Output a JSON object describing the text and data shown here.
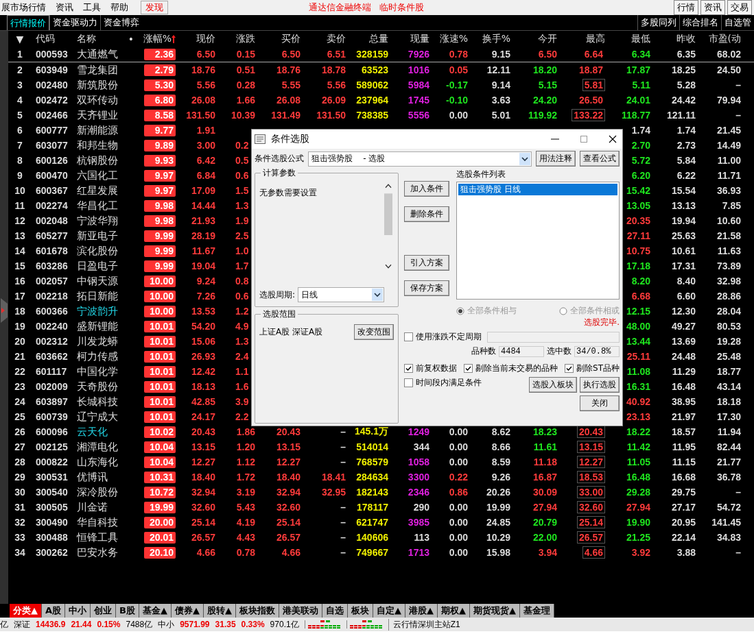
{
  "menu_bar": {
    "items": [
      {
        "label": "展市场行情",
        "selected": false
      },
      {
        "label": "资讯",
        "selected": false
      },
      {
        "label": "工具",
        "selected": false
      },
      {
        "label": "帮助",
        "selected": false
      },
      {
        "label": "发现",
        "selected": true
      }
    ],
    "title": "通达信金融终端",
    "subtitle": "临时条件股",
    "buttons": [
      "行情",
      "资讯",
      "交易"
    ]
  },
  "tabs": [
    {
      "label": "行情报价",
      "selected": true
    },
    {
      "label": "资金驱动力",
      "selected": false
    },
    {
      "label": "资金博弈",
      "selected": false
    }
  ],
  "right_tabs": [
    "多股同列",
    "综合排名",
    "自选管"
  ],
  "table": {
    "columns": [
      {
        "label": "▼",
        "sorted": false
      },
      {
        "label": "代码",
        "sorted": false
      },
      {
        "label": "名称",
        "sorted": false
      },
      {
        "label": "•",
        "sorted": false
      },
      {
        "label": "涨幅%",
        "sorted": true
      },
      {
        "label": "现价",
        "sorted": false
      },
      {
        "label": "涨跌",
        "sorted": false
      },
      {
        "label": "买价",
        "sorted": false
      },
      {
        "label": "卖价",
        "sorted": false
      },
      {
        "label": "总量",
        "sorted": false
      },
      {
        "label": "现量",
        "sorted": false
      },
      {
        "label": "涨速%",
        "sorted": false
      },
      {
        "label": "换手%",
        "sorted": false
      },
      {
        "label": "今开",
        "sorted": false
      },
      {
        "label": "最高",
        "sorted": false
      },
      {
        "label": "最低",
        "sorted": false
      },
      {
        "label": "昨收",
        "sorted": false
      },
      {
        "label": "市盈(动",
        "sorted": false
      }
    ],
    "rows": [
      {
        "no": "1",
        "code": "000593",
        "name": "大通燃气",
        "highlighted": false,
        "pct": "2.36",
        "price": "6.50",
        "chg": "0.15",
        "bid": "6.50",
        "ask": "6.51",
        "vol": "328159",
        "cur": "7926",
        "buy_side": true,
        "speed": "0.78",
        "turnover": "9.15",
        "open": "6.50",
        "high": "6.64",
        "high_boxed": false,
        "low": "6.34",
        "prev": "6.35",
        "pe": "68.02"
      },
      {
        "no": "2",
        "code": "603949",
        "name": "雪龙集团",
        "highlighted": false,
        "pct": "2.79",
        "price": "18.76",
        "chg": "0.51",
        "bid": "18.76",
        "ask": "18.78",
        "vol": "63523",
        "cur": "1016",
        "buy_side": true,
        "speed": "0.05",
        "turnover": "12.11",
        "open": "18.20",
        "high": "18.87",
        "high_boxed": false,
        "low": "17.87",
        "prev": "18.25",
        "pe": "24.50"
      },
      {
        "no": "3",
        "code": "002480",
        "name": "新筑股份",
        "highlighted": false,
        "pct": "5.30",
        "price": "5.56",
        "chg": "0.28",
        "bid": "5.55",
        "ask": "5.56",
        "vol": "589062",
        "cur": "5984",
        "buy_side": true,
        "speed": "-0.17",
        "turnover": "9.14",
        "open": "5.15",
        "high": "5.81",
        "high_boxed": true,
        "low": "5.11",
        "prev": "5.28",
        "pe": "–"
      },
      {
        "no": "4",
        "code": "002472",
        "name": "双环传动",
        "highlighted": false,
        "pct": "6.80",
        "price": "26.08",
        "chg": "1.66",
        "bid": "26.08",
        "ask": "26.09",
        "vol": "237964",
        "cur": "1745",
        "buy_side": true,
        "speed": "-0.10",
        "turnover": "3.63",
        "open": "24.20",
        "high": "26.50",
        "high_boxed": false,
        "low": "24.01",
        "prev": "24.42",
        "pe": "79.94"
      },
      {
        "no": "5",
        "code": "002466",
        "name": "天齐锂业",
        "highlighted": false,
        "pct": "8.58",
        "price": "131.50",
        "chg": "10.39",
        "bid": "131.49",
        "ask": "131.50",
        "vol": "738385",
        "cur": "5556",
        "buy_side": true,
        "speed": "0.00",
        "turnover": "5.01",
        "open": "119.92",
        "high": "133.22",
        "high_boxed": true,
        "low": "118.77",
        "prev": "121.11",
        "pe": "–"
      },
      {
        "no": "6",
        "code": "600777",
        "name": "新潮能源",
        "highlighted": false,
        "pct": "9.77",
        "price": "1.91",
        "low": "1.74",
        "prev": "1.74",
        "pe": "21.45"
      },
      {
        "no": "7",
        "code": "603077",
        "name": "和邦生物",
        "highlighted": false,
        "pct": "9.89",
        "price": "3.00",
        "chg": "0.2",
        "low": "2.70",
        "prev": "2.73",
        "pe": "14.49"
      },
      {
        "no": "8",
        "code": "600126",
        "name": "杭钢股份",
        "highlighted": false,
        "pct": "9.93",
        "price": "6.42",
        "chg": "0.5",
        "low": "5.72",
        "prev": "5.84",
        "pe": "11.00"
      },
      {
        "no": "9",
        "code": "600470",
        "name": "六国化工",
        "highlighted": false,
        "pct": "9.97",
        "price": "6.84",
        "chg": "0.6",
        "low": "6.20",
        "prev": "6.22",
        "pe": "11.71"
      },
      {
        "no": "10",
        "code": "600367",
        "name": "红星发展",
        "highlighted": false,
        "pct": "9.97",
        "price": "17.09",
        "chg": "1.5",
        "low": "15.42",
        "prev": "15.54",
        "pe": "36.93"
      },
      {
        "no": "11",
        "code": "002274",
        "name": "华昌化工",
        "highlighted": false,
        "pct": "9.98",
        "price": "14.44",
        "chg": "1.3",
        "low": "13.05",
        "prev": "13.13",
        "pe": "7.85"
      },
      {
        "no": "12",
        "code": "002048",
        "name": "宁波华翔",
        "highlighted": false,
        "pct": "9.98",
        "price": "21.93",
        "chg": "1.9",
        "low": "20.35",
        "prev": "19.94",
        "pe": "10.60"
      },
      {
        "no": "13",
        "code": "605277",
        "name": "新亚电子",
        "highlighted": false,
        "pct": "9.99",
        "price": "28.19",
        "chg": "2.5",
        "low": "27.11",
        "prev": "25.63",
        "pe": "21.58"
      },
      {
        "no": "14",
        "code": "601678",
        "name": "滨化股份",
        "highlighted": false,
        "pct": "9.99",
        "price": "11.67",
        "chg": "1.0",
        "low": "10.75",
        "prev": "10.61",
        "pe": "11.63"
      },
      {
        "no": "15",
        "code": "603286",
        "name": "日盈电子",
        "highlighted": false,
        "pct": "9.99",
        "price": "19.04",
        "chg": "1.7",
        "low": "17.18",
        "prev": "17.31",
        "pe": "73.89"
      },
      {
        "no": "16",
        "code": "002057",
        "name": "中钢天源",
        "highlighted": false,
        "pct": "10.00",
        "price": "9.24",
        "chg": "0.8",
        "low": "8.20",
        "prev": "8.40",
        "pe": "32.98"
      },
      {
        "no": "17",
        "code": "002218",
        "name": "拓日新能",
        "highlighted": false,
        "pct": "10.00",
        "price": "7.26",
        "chg": "0.6",
        "low": "6.68",
        "prev": "6.60",
        "pe": "28.86"
      },
      {
        "no": "18",
        "code": "600366",
        "name": "宁波韵升",
        "highlighted": true,
        "pct": "10.00",
        "price": "13.53",
        "chg": "1.2",
        "low": "12.15",
        "prev": "12.30",
        "pe": "28.04"
      },
      {
        "no": "19",
        "code": "002240",
        "name": "盛新锂能",
        "highlighted": false,
        "pct": "10.01",
        "price": "54.20",
        "chg": "4.9",
        "low": "48.00",
        "prev": "49.27",
        "pe": "80.53"
      },
      {
        "no": "20",
        "code": "002312",
        "name": "川发龙蟒",
        "highlighted": false,
        "pct": "10.01",
        "price": "15.06",
        "chg": "1.3",
        "low": "13.44",
        "prev": "13.69",
        "pe": "19.28"
      },
      {
        "no": "21",
        "code": "603662",
        "name": "柯力传感",
        "highlighted": false,
        "pct": "10.01",
        "price": "26.93",
        "chg": "2.4",
        "low": "25.11",
        "prev": "24.48",
        "pe": "25.48"
      },
      {
        "no": "22",
        "code": "601117",
        "name": "中国化学",
        "highlighted": false,
        "pct": "10.01",
        "price": "12.42",
        "chg": "1.1",
        "low": "11.08",
        "prev": "11.29",
        "pe": "18.77"
      },
      {
        "no": "23",
        "code": "002009",
        "name": "天奇股份",
        "highlighted": false,
        "pct": "10.01",
        "price": "18.13",
        "chg": "1.6",
        "low": "16.31",
        "prev": "16.48",
        "pe": "43.14"
      },
      {
        "no": "24",
        "code": "603897",
        "name": "长城科技",
        "highlighted": false,
        "pct": "10.01",
        "price": "42.85",
        "chg": "3.9",
        "low": "40.92",
        "prev": "38.95",
        "pe": "18.18"
      },
      {
        "no": "25",
        "code": "600739",
        "name": "辽宁成大",
        "highlighted": false,
        "pct": "10.01",
        "price": "24.17",
        "chg": "2.2",
        "low": "23.13",
        "prev": "21.97",
        "pe": "17.30"
      },
      {
        "no": "26",
        "code": "600096",
        "name": "云天化",
        "highlighted": true,
        "pct": "10.02",
        "price": "20.43",
        "chg": "1.86",
        "bid": "20.43",
        "ask": "–",
        "vol": "145.1万",
        "cur": "1249",
        "buy_side": true,
        "speed": "0.00",
        "turnover": "8.62",
        "open": "18.23",
        "high": "20.43",
        "high_boxed": true,
        "low": "18.22",
        "prev": "18.57",
        "pe": "11.94"
      },
      {
        "no": "27",
        "code": "002125",
        "name": "湘潭电化",
        "highlighted": false,
        "pct": "10.04",
        "price": "13.15",
        "chg": "1.20",
        "bid": "13.15",
        "ask": "–",
        "vol": "514014",
        "cur": "344",
        "buy_side": false,
        "speed": "0.00",
        "turnover": "8.66",
        "open": "11.61",
        "high": "13.15",
        "high_boxed": true,
        "low": "11.42",
        "prev": "11.95",
        "pe": "82.44"
      },
      {
        "no": "28",
        "code": "000822",
        "name": "山东海化",
        "highlighted": false,
        "pct": "10.04",
        "price": "12.27",
        "chg": "1.12",
        "bid": "12.27",
        "ask": "–",
        "vol": "768579",
        "cur": "1058",
        "buy_side": true,
        "speed": "0.00",
        "turnover": "8.59",
        "open": "11.18",
        "high": "12.27",
        "high_boxed": true,
        "low": "11.05",
        "prev": "11.15",
        "pe": "21.77"
      },
      {
        "no": "29",
        "code": "300531",
        "name": "优博讯",
        "highlighted": false,
        "pct": "10.31",
        "price": "18.40",
        "chg": "1.72",
        "bid": "18.40",
        "ask": "18.41",
        "vol": "284634",
        "cur": "3300",
        "buy_side": true,
        "speed": "0.22",
        "turnover": "9.26",
        "open": "16.87",
        "high": "18.53",
        "high_boxed": true,
        "low": "16.48",
        "prev": "16.68",
        "pe": "36.78"
      },
      {
        "no": "30",
        "code": "300540",
        "name": "深冷股份",
        "highlighted": false,
        "pct": "10.72",
        "price": "32.94",
        "chg": "3.19",
        "bid": "32.94",
        "ask": "32.95",
        "vol": "182143",
        "cur": "2346",
        "buy_side": true,
        "speed": "0.86",
        "turnover": "20.26",
        "open": "30.09",
        "high": "33.00",
        "high_boxed": true,
        "low": "29.28",
        "prev": "29.75",
        "pe": "–"
      },
      {
        "no": "31",
        "code": "300505",
        "name": "川金诺",
        "highlighted": false,
        "pct": "19.99",
        "price": "32.60",
        "chg": "5.43",
        "bid": "32.60",
        "ask": "–",
        "vol": "178117",
        "cur": "290",
        "buy_side": false,
        "speed": "0.00",
        "turnover": "19.99",
        "open": "27.94",
        "high": "32.60",
        "high_boxed": true,
        "low": "27.94",
        "prev": "27.17",
        "pe": "54.72"
      },
      {
        "no": "32",
        "code": "300490",
        "name": "华自科技",
        "highlighted": false,
        "pct": "20.00",
        "price": "25.14",
        "chg": "4.19",
        "bid": "25.14",
        "ask": "–",
        "vol": "621747",
        "cur": "3985",
        "buy_side": true,
        "speed": "0.00",
        "turnover": "24.85",
        "open": "20.79",
        "high": "25.14",
        "high_boxed": true,
        "low": "19.90",
        "prev": "20.95",
        "pe": "141.45"
      },
      {
        "no": "33",
        "code": "300488",
        "name": "恒锋工具",
        "highlighted": false,
        "pct": "20.01",
        "price": "26.57",
        "chg": "4.43",
        "bid": "26.57",
        "ask": "–",
        "vol": "140606",
        "cur": "113",
        "buy_side": false,
        "speed": "0.00",
        "turnover": "10.29",
        "open": "22.00",
        "high": "26.57",
        "high_boxed": true,
        "low": "21.25",
        "prev": "22.14",
        "pe": "34.83"
      },
      {
        "no": "34",
        "code": "300262",
        "name": "巴安水务",
        "highlighted": false,
        "pct": "20.10",
        "price": "4.66",
        "chg": "0.78",
        "bid": "4.66",
        "ask": "–",
        "vol": "749667",
        "cur": "1713",
        "buy_side": true,
        "speed": "0.00",
        "turnover": "15.98",
        "open": "3.94",
        "high": "4.66",
        "high_boxed": true,
        "low": "3.92",
        "prev": "3.88",
        "pe": "–"
      }
    ]
  },
  "category_tabs": [
    {
      "label": "分类▲",
      "selected": true
    },
    {
      "label": "A股",
      "selected": false
    },
    {
      "label": "中小",
      "selected": false
    },
    {
      "label": "创业",
      "selected": false
    },
    {
      "label": "B股",
      "selected": false
    },
    {
      "label": "基金▲",
      "selected": false
    },
    {
      "label": "债券▲",
      "selected": false
    },
    {
      "label": "股转▲",
      "selected": false
    },
    {
      "label": "板块指数",
      "selected": false
    },
    {
      "label": "港美联动",
      "selected": false
    },
    {
      "label": "自选",
      "selected": false
    },
    {
      "label": "板块",
      "selected": false
    },
    {
      "label": "自定▲",
      "selected": false
    },
    {
      "label": "港股▲",
      "selected": false
    },
    {
      "label": "期权▲",
      "selected": false
    },
    {
      "label": "期货现货▲",
      "selected": false
    },
    {
      "label": "基金理",
      "selected": false
    }
  ],
  "status_bar": [
    {
      "kind": "label",
      "text": "亿"
    },
    {
      "kind": "label",
      "text": "深证"
    },
    {
      "kind": "up",
      "text": "14436.9"
    },
    {
      "kind": "up",
      "text": "21.44"
    },
    {
      "kind": "up",
      "text": "0.15%"
    },
    {
      "kind": "label",
      "text": "7488亿"
    },
    {
      "kind": "label",
      "text": "中小"
    },
    {
      "kind": "up",
      "text": "9571.99"
    },
    {
      "kind": "up",
      "text": "31.35"
    },
    {
      "kind": "up",
      "text": "0.33%"
    },
    {
      "kind": "label",
      "text": "970.1亿"
    },
    {
      "kind": "meter"
    },
    {
      "kind": "meter"
    },
    {
      "kind": "server",
      "text": "云行情深圳主站Z1"
    }
  ],
  "dialog": {
    "title": "条件选股",
    "formula_label": "条件选股公式",
    "formula": "狙击强势股    - 选股",
    "top_buttons": [
      "用法注释",
      "查看公式"
    ],
    "params_group": {
      "title": "计算参数",
      "text": "无参数需要设置",
      "period_label": "选股周期:",
      "period": "日线"
    },
    "action_buttons": [
      "加入条件",
      "删除条件",
      "引入方案",
      "保存方案"
    ],
    "list_label": "选股条件列表",
    "conditions": [
      {
        "text": "狙击强势股   日线",
        "selected": true
      }
    ],
    "radios": [
      {
        "label": "全部条件相与",
        "selected": true,
        "disabled": true
      },
      {
        "label": "全部条件相或",
        "selected": false,
        "disabled": true
      }
    ],
    "status": "选股完毕.",
    "range_group": {
      "title": "选股范围",
      "text": "上证A股  深证A股",
      "button": "改变范围"
    },
    "period_option": {
      "label": "使用涨跌不定周期",
      "checked": false
    },
    "counts": [
      {
        "label": "品种数",
        "value": "4484"
      },
      {
        "label": "选中数",
        "value": "34/0.8%"
      }
    ],
    "filters": [
      {
        "label": "前复权数据",
        "checked": true
      },
      {
        "label": "剔除当前未交易的品种",
        "checked": true
      },
      {
        "label": "剔除ST品种",
        "checked": true
      }
    ],
    "time_option": {
      "label": "时间段内满足条件",
      "checked": false
    },
    "bottom_buttons": [
      "选股入板块",
      "执行选股",
      "关闭"
    ]
  }
}
